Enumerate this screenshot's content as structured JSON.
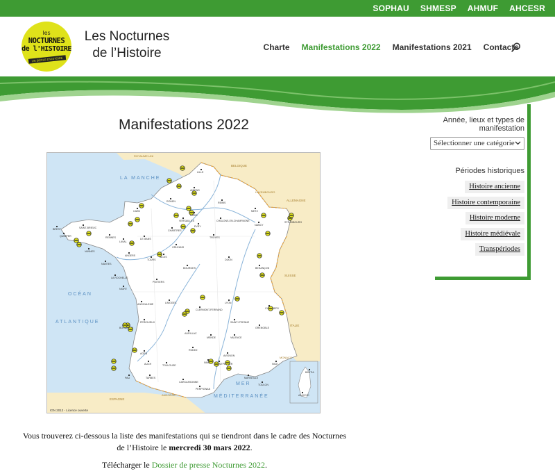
{
  "topbar": {
    "links": [
      "SOPHAU",
      "SHMESP",
      "AHMUF",
      "AHCESR"
    ]
  },
  "logo": {
    "line1": "les",
    "line2": "NOCTURNES",
    "line3": "de l'HISTOIRE",
    "band": "UN SIÈCLE D'HISTOIRE",
    "icon": "round-yellow-logo"
  },
  "site": {
    "title_line1": "Les Nocturnes",
    "title_line2": "de l’Histoire"
  },
  "nav": {
    "items": [
      "Charte",
      "Manifestations 2022",
      "Manifestations 2021",
      "Contacts"
    ],
    "active_index": 1,
    "search_icon": "search-icon"
  },
  "main": {
    "title": "Manifestations 2022",
    "map": {
      "seas": [
        "LA MANCHE",
        "OCÉAN",
        "ATLANTIQUE",
        "MER",
        "MÉDITERRANÉE"
      ],
      "countries": [
        "ROYAUME-UNI",
        "BELGIQUE",
        "LUXEMBOURG",
        "ALLEMAGNE",
        "SUISSE",
        "ITALIE",
        "ESPAGNE",
        "ANDORRE",
        "MONACO"
      ],
      "cities": [
        "LILLE",
        "AMIENS",
        "ROUEN",
        "CAEN",
        "PARIS",
        "VERSAILLES",
        "EVRY",
        "CHARTRES",
        "ORLEANS",
        "LE MANS",
        "LAVAL",
        "RENNES",
        "SAINT-BRIEUC",
        "QUIMPER",
        "VANNES",
        "NANTES",
        "ANGERS",
        "TOURS",
        "BLOIS",
        "BOURGES",
        "POITIERS",
        "LA ROCHELLE",
        "NIORT",
        "LIMOGES",
        "ANGOULEME",
        "PERIGUEUX",
        "BORDEAUX",
        "AGEN",
        "PAU",
        "TARBES",
        "TOULOUSE",
        "AUCH",
        "MONTPELLIER",
        "NIMES",
        "MARSEILLE",
        "TOULON",
        "NICE",
        "AVIGNON",
        "VALENCE",
        "GRENOBLE",
        "CHAMBERY",
        "LYON",
        "SAINT-ETIENNE",
        "CLERMONT-FERRAND",
        "DIJON",
        "BESANÇON",
        "STRASBOURG",
        "METZ",
        "NANCY",
        "REIMS",
        "CHÂLONS-EN-CHAMPAGNE",
        "TROYES",
        "AJACCIO",
        "BASTIA",
        "PERPIGNAN",
        "CARCASSONNE",
        "RODEZ",
        "MENDE",
        "AURILLAC",
        "BREST"
      ],
      "credit": "IGN 2012 - Licence ouverte"
    },
    "intro_text_pre": "Vous trouverez ci-dessous la liste des manifestations qui se tiendront dans le cadre des Nocturnes de l’Histoire le ",
    "intro_text_bold": "mercredi 30 mars 2022",
    "intro_text_post": ".",
    "download_pre": "Télécharger le ",
    "download_link": "Dossier de presse Nocturnes 2022",
    "download_post": "."
  },
  "sidebar": {
    "filter_title": "Année, lieux et types de manifestation",
    "select_value": "Sélectionner une catégorie",
    "periods_title": "Périodes historiques",
    "tags": [
      "Histoire ancienne",
      "Histoire contemporaine",
      "Histoire moderne",
      "Histoire médiévale",
      "Transpériodes"
    ]
  },
  "colors": {
    "green": "#3e9b33",
    "logo_yellow": "#dfe21a"
  }
}
